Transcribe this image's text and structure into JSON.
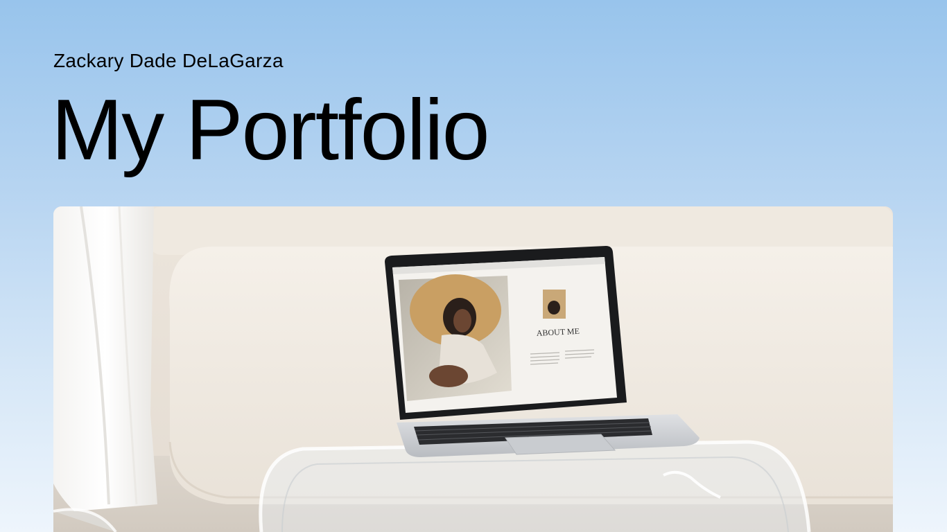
{
  "header": {
    "author_name": "Zackary Dade DeLaGarza",
    "title": "My Portfolio"
  },
  "hero": {
    "screen_heading": "ABOUT ME"
  },
  "colors": {
    "background_top": "#98c4ec",
    "background_bottom": "#eef5fc",
    "text": "#000000",
    "sofa": "#f1ebe2",
    "laptop_silver": "#cfd2d6"
  }
}
